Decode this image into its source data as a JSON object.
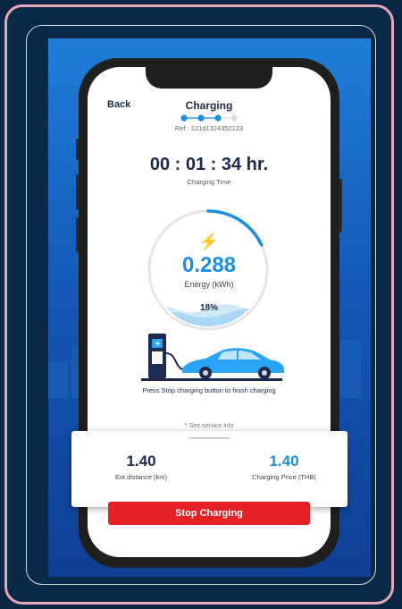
{
  "header": {
    "back_label": "Back",
    "title": "Charging",
    "steps_total": 4,
    "steps_done": 3,
    "ref": "Ref : 121d1324352123"
  },
  "timer": {
    "value": "00 : 01 : 34 hr.",
    "label": "Charging Time"
  },
  "gauge": {
    "icon": "lightning-bolt-icon",
    "energy_value": "0.288",
    "energy_label": "Energy (kWh)",
    "percent_label": "18%",
    "battery_fraction": 0.18
  },
  "hint": "Press Stop charging button to finish charging",
  "service_info": "^ See service info",
  "stats": {
    "distance_value": "1.40",
    "distance_label": "Est.distance (km)",
    "price_value": "1.40",
    "price_label": "Charging Price (THB)"
  },
  "stop_button": "Stop Charging",
  "colors": {
    "accent_blue": "#1b8ee0",
    "navy": "#1b2a4e",
    "stop_red": "#e52125",
    "frame_pink": "#e8a6b8"
  }
}
